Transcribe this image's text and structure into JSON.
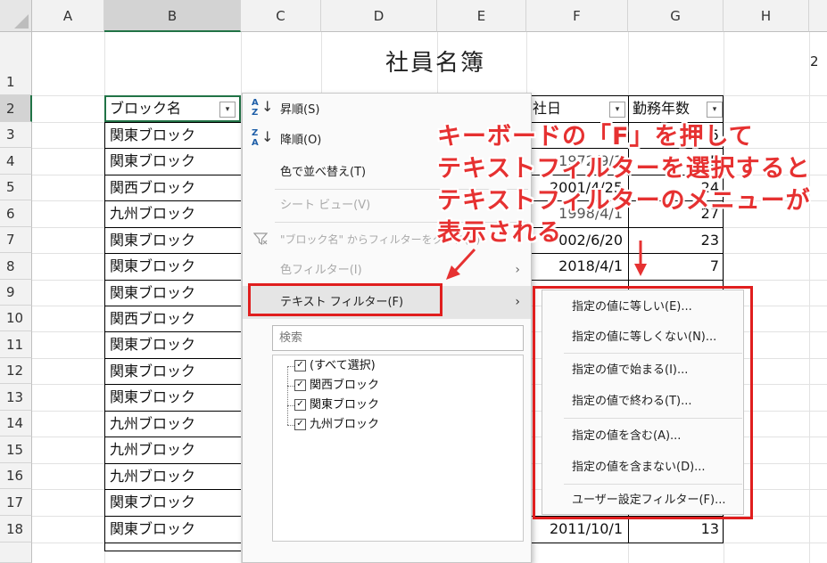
{
  "sheet": {
    "columns": [
      "A",
      "B",
      "C",
      "D",
      "E",
      "F",
      "G",
      "H"
    ],
    "rows": [
      "1",
      "2",
      "3",
      "4",
      "5",
      "6",
      "7",
      "8",
      "9",
      "10",
      "11",
      "12",
      "13",
      "14",
      "15",
      "16",
      "17",
      "18"
    ],
    "title": "社員名簿",
    "stray_cell": "2",
    "header_b": "ブロック名",
    "header_f": "社日",
    "header_g": "勤務年数",
    "block_names": [
      "関東ブロック",
      "関東ブロック",
      "関西ブロック",
      "九州ブロック",
      "関東ブロック",
      "関東ブロック",
      "関東ブロック",
      "関西ブロック",
      "関東ブロック",
      "関東ブロック",
      "関東ブロック",
      "九州ブロック",
      "九州ブロック",
      "九州ブロック",
      "関東ブロック",
      "関東ブロック"
    ],
    "f_visible": {
      "r4": "1972/9/1",
      "r5": "2001/4/25",
      "r6": "1998/4/1",
      "r7": "002/6/20",
      "r8": "2018/4/1",
      "r18": "2011/10/1"
    },
    "g_visible": {
      "r3": "5",
      "r4": "5",
      "r5": "24",
      "r6": "27",
      "r7": "23",
      "r8": "7",
      "r18": "13"
    }
  },
  "filter_menu": {
    "sort_asc": "昇順(S)",
    "sort_desc": "降順(O)",
    "sort_color": "色で並べ替え(T)",
    "sheet_view": "シート ビュー(V)",
    "clear_filter": "\"ブロック名\" からフィルターをクリア(C)",
    "color_filter": "色フィルター(I)",
    "text_filter": "テキスト フィルター(F)",
    "search_placeholder": "検索",
    "checklist": [
      "(すべて選択)",
      "関西ブロック",
      "関東ブロック",
      "九州ブロック"
    ]
  },
  "text_filter_submenu": [
    "指定の値に等しい(E)...",
    "指定の値に等しくない(N)...",
    "指定の値で始まる(I)...",
    "指定の値で終わる(T)...",
    "指定の値を含む(A)...",
    "指定の値を含まない(D)...",
    "ユーザー設定フィルター(F)..."
  ],
  "annotation": {
    "line1": "キーボードの「F」を押して",
    "line2": "テキストフィルターを選択すると",
    "line3": "テキストフィルターのメニューが",
    "line4": "表示される"
  },
  "colors": {
    "accent_green": "#217346",
    "annotation_red": "#e63131",
    "highlight_box": "#e01e1e"
  }
}
